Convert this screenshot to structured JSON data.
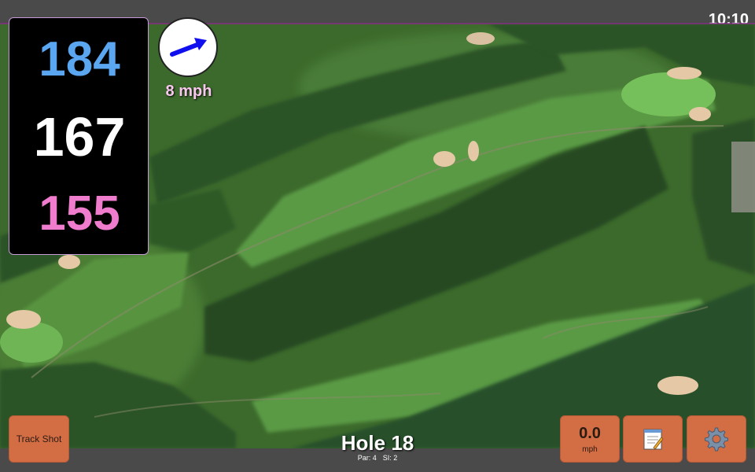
{
  "status": {
    "time": "10:10"
  },
  "distances": {
    "back": {
      "value": "184",
      "color": "#5aa6f0"
    },
    "middle": {
      "value": "167",
      "color": "#ffffff"
    },
    "front": {
      "value": "155",
      "color": "#f07ccd"
    }
  },
  "wind": {
    "speed_label": "8 mph",
    "speed_color": "#f8c8ee",
    "icon": "wind-direction-arrow-icon",
    "arrow_color": "#1010ee"
  },
  "buttons": {
    "track_shot": "Track Shot",
    "speed": {
      "value": "0.0",
      "unit": "mph"
    },
    "notes_icon": "notepad-icon",
    "settings_icon": "gear-icon",
    "accent": "#d26d44"
  },
  "hole": {
    "title": "Hole 18",
    "par": "Par: 4",
    "si": "SI: 2"
  },
  "map": {
    "type": "satellite-golf-course",
    "fairway": "#4e8f3a",
    "trees": "#254a22",
    "bunker": "#e5c8a6"
  }
}
